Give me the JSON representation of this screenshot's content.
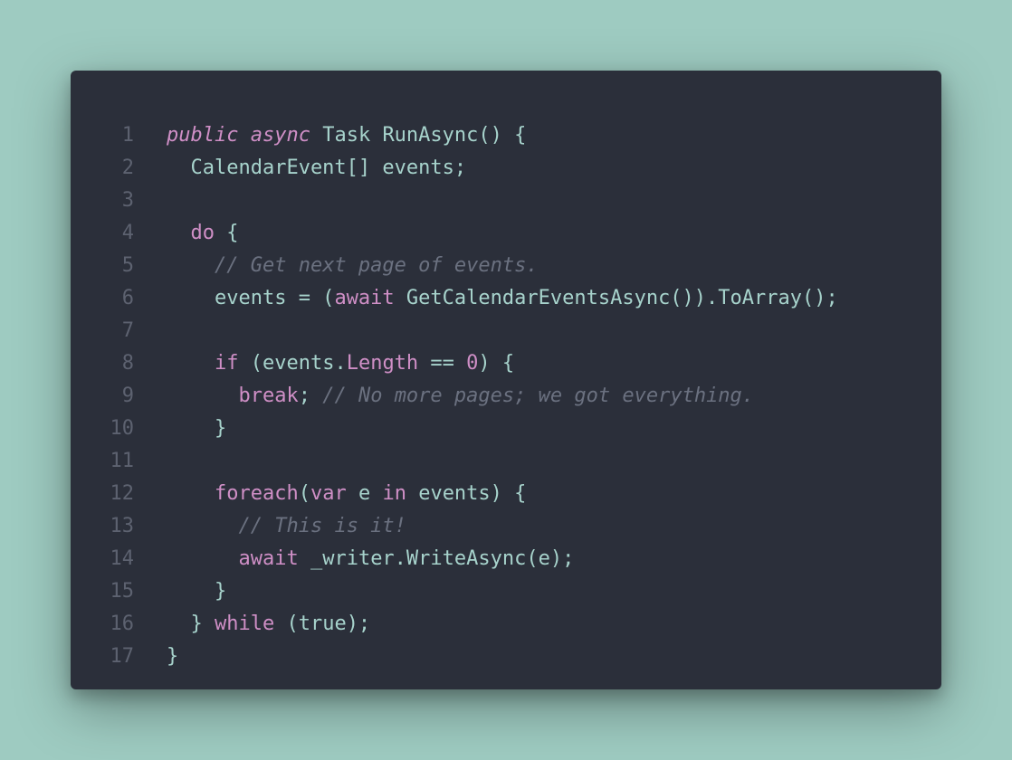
{
  "colors": {
    "background": "#9ecbc1",
    "panel": "#2b2f3a",
    "text": "#a7d3cc",
    "keyword": "#cf8fc6",
    "comment": "#6b7180",
    "line_number": "#5d6270"
  },
  "lines": [
    {
      "n": "1",
      "tokens": [
        {
          "t": "public",
          "c": "kwi"
        },
        {
          "t": " "
        },
        {
          "t": "async",
          "c": "kwi"
        },
        {
          "t": " Task RunAsync() {"
        }
      ]
    },
    {
      "n": "2",
      "tokens": [
        {
          "t": "  CalendarEvent[] events;"
        }
      ]
    },
    {
      "n": "3",
      "tokens": []
    },
    {
      "n": "4",
      "tokens": [
        {
          "t": "  "
        },
        {
          "t": "do",
          "c": "kw"
        },
        {
          "t": " {"
        }
      ]
    },
    {
      "n": "5",
      "tokens": [
        {
          "t": "    "
        },
        {
          "t": "// Get next page of events.",
          "c": "cm"
        }
      ]
    },
    {
      "n": "6",
      "tokens": [
        {
          "t": "    events = ("
        },
        {
          "t": "await",
          "c": "kw"
        },
        {
          "t": " GetCalendarEventsAsync()).ToArray();"
        }
      ]
    },
    {
      "n": "7",
      "tokens": []
    },
    {
      "n": "8",
      "tokens": [
        {
          "t": "    "
        },
        {
          "t": "if",
          "c": "kw"
        },
        {
          "t": " (events."
        },
        {
          "t": "Length",
          "c": "kw"
        },
        {
          "t": " == "
        },
        {
          "t": "0",
          "c": "nm"
        },
        {
          "t": ") {"
        }
      ]
    },
    {
      "n": "9",
      "tokens": [
        {
          "t": "      "
        },
        {
          "t": "break",
          "c": "kw"
        },
        {
          "t": "; "
        },
        {
          "t": "// No more pages; we got everything.",
          "c": "cm"
        }
      ]
    },
    {
      "n": "10",
      "tokens": [
        {
          "t": "    }"
        }
      ]
    },
    {
      "n": "11",
      "tokens": []
    },
    {
      "n": "12",
      "tokens": [
        {
          "t": "    "
        },
        {
          "t": "foreach",
          "c": "kw"
        },
        {
          "t": "("
        },
        {
          "t": "var",
          "c": "kw"
        },
        {
          "t": " e "
        },
        {
          "t": "in",
          "c": "kw"
        },
        {
          "t": " events) {"
        }
      ]
    },
    {
      "n": "13",
      "tokens": [
        {
          "t": "      "
        },
        {
          "t": "// This is it!",
          "c": "cm"
        }
      ]
    },
    {
      "n": "14",
      "tokens": [
        {
          "t": "      "
        },
        {
          "t": "await",
          "c": "kw"
        },
        {
          "t": " _writer.WriteAsync(e);"
        }
      ]
    },
    {
      "n": "15",
      "tokens": [
        {
          "t": "    }"
        }
      ]
    },
    {
      "n": "16",
      "tokens": [
        {
          "t": "  } "
        },
        {
          "t": "while",
          "c": "kw"
        },
        {
          "t": " (true);"
        }
      ]
    },
    {
      "n": "17",
      "tokens": [
        {
          "t": "}"
        }
      ]
    }
  ]
}
